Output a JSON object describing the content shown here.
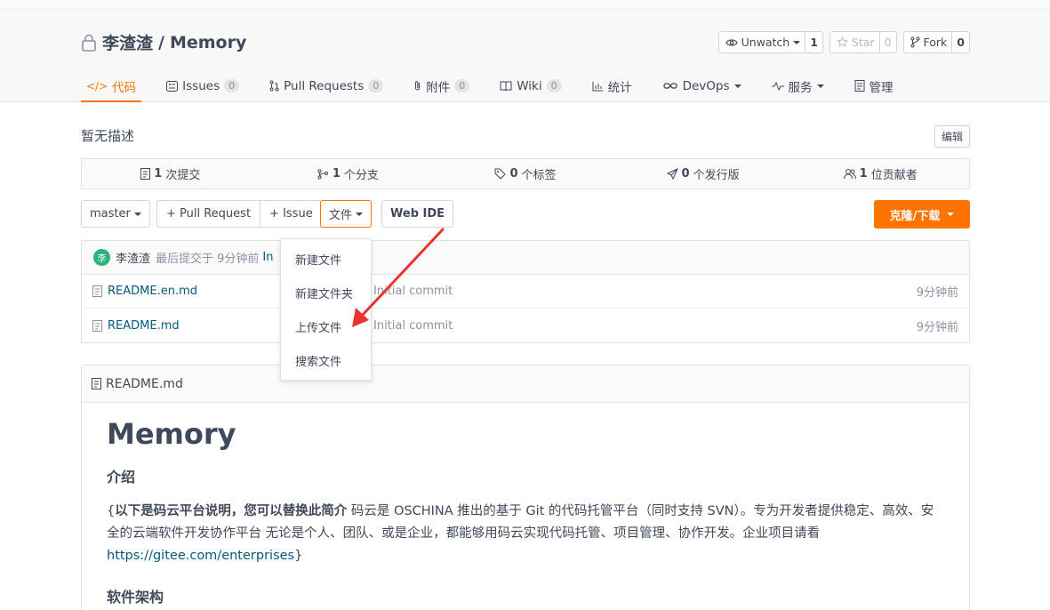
{
  "repo": {
    "owner": "李渣渣",
    "separator": "/",
    "name": "Memory",
    "actions": {
      "watch": {
        "label": "Unwatch",
        "count": "1"
      },
      "star": {
        "label": "Star",
        "count": "0"
      },
      "fork": {
        "label": "Fork",
        "count": "0"
      }
    }
  },
  "tabs": [
    {
      "label": "代码",
      "icon": "code-icon",
      "active": true
    },
    {
      "label": "Issues",
      "badge": "0",
      "icon": "issues-icon"
    },
    {
      "label": "Pull Requests",
      "badge": "0",
      "icon": "pull-request-icon"
    },
    {
      "label": "附件",
      "badge": "0",
      "icon": "paperclip-icon"
    },
    {
      "label": "Wiki",
      "badge": "0",
      "icon": "book-icon"
    },
    {
      "label": "统计",
      "icon": "bar-chart-icon"
    },
    {
      "label": "DevOps",
      "icon": "infinity-icon"
    },
    {
      "label": "服务",
      "icon": "pulse-icon"
    },
    {
      "label": "管理",
      "icon": "settings-doc-icon"
    }
  ],
  "description": {
    "text": "暂无描述",
    "edit_label": "编辑"
  },
  "stats": [
    {
      "count": "1",
      "label": "次提交",
      "icon": "commit-doc-icon"
    },
    {
      "count": "1",
      "label": "个分支",
      "icon": "branch-icon"
    },
    {
      "count": "0",
      "label": "个标签",
      "icon": "tag-icon"
    },
    {
      "count": "0",
      "label": "个发行版",
      "icon": "release-icon"
    },
    {
      "count": "1",
      "label": "位贡献者",
      "icon": "contributors-icon"
    }
  ],
  "toolbar": {
    "branch": "master",
    "pull_request": "+ Pull Request",
    "issue": "+ Issue",
    "file": "文件",
    "web_ide": "Web IDE",
    "clone": "克隆/下载"
  },
  "last_commit": {
    "avatar_char": "李",
    "author": "李渣渣",
    "text": "最后提交于 9分钟前",
    "message": "In"
  },
  "files": [
    {
      "name": "README.en.md",
      "message": "Initial commit",
      "time": "9分钟前"
    },
    {
      "name": "README.md",
      "message": "Initial commit",
      "time": "9分钟前"
    }
  ],
  "file_menu": [
    {
      "label": "新建文件"
    },
    {
      "label": "新建文件夹"
    },
    {
      "label": "上传文件"
    },
    {
      "label": "搜索文件"
    }
  ],
  "readme": {
    "filename": "README.md",
    "title": "Memory",
    "intro_heading": "介绍",
    "intro_prefix": "{",
    "intro_bold": "以下是码云平台说明，您可以替换此简介",
    "intro_text": " 码云是 OSCHINA 推出的基于 Git 的代码托管平台（同时支持 SVN）。专为开发者提供稳定、高效、安全的云端软件开发协作平台 无论是个人、团队、或是企业，都能够用码云实现代码托管、项目管理、协作开发。企业项目请看 ",
    "intro_link": "https://gitee.com/enterprises",
    "intro_suffix": "}",
    "arch_heading": "软件架构"
  },
  "colors": {
    "accent": "#fe7300",
    "link": "#005980",
    "annotation_arrow": "#e8332f"
  }
}
